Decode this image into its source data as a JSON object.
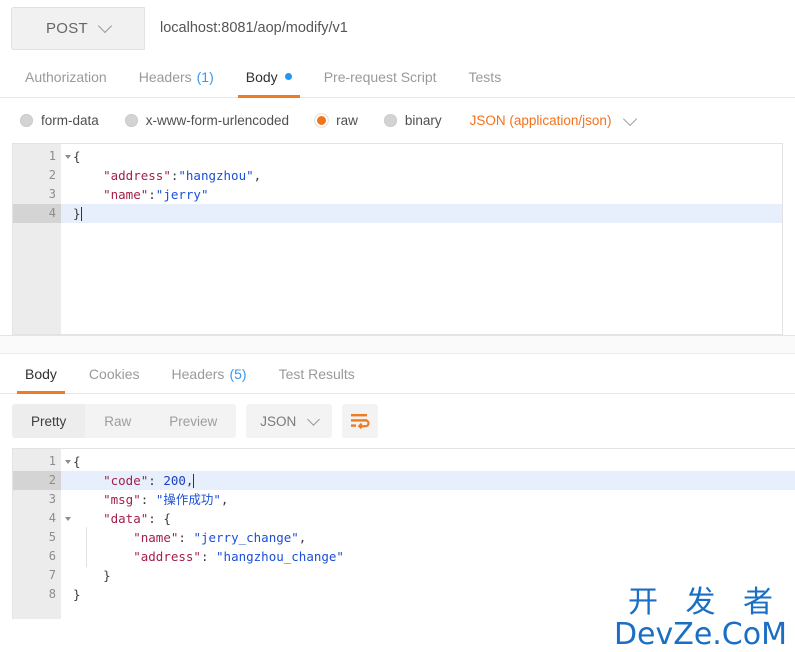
{
  "request": {
    "method": "POST",
    "url": "localhost:8081/aop/modify/v1",
    "tabs": [
      {
        "label": "Authorization",
        "count": "",
        "active": false,
        "dot": false
      },
      {
        "label": "Headers",
        "count": "(1)",
        "active": false,
        "dot": false
      },
      {
        "label": "Body",
        "count": "",
        "active": true,
        "dot": true
      },
      {
        "label": "Pre-request Script",
        "count": "",
        "active": false,
        "dot": false
      },
      {
        "label": "Tests",
        "count": "",
        "active": false,
        "dot": false
      }
    ],
    "body_types": [
      {
        "label": "form-data",
        "selected": false
      },
      {
        "label": "x-www-form-urlencoded",
        "selected": false
      },
      {
        "label": "raw",
        "selected": true
      },
      {
        "label": "binary",
        "selected": false
      }
    ],
    "content_type": "JSON (application/json)",
    "body_lines": [
      {
        "n": "1",
        "fold": true,
        "active": false,
        "tokens": [
          {
            "t": "{",
            "c": "p"
          }
        ]
      },
      {
        "n": "2",
        "fold": false,
        "active": false,
        "tokens": [
          {
            "t": "    ",
            "c": "p"
          },
          {
            "t": "\"address\"",
            "c": "k"
          },
          {
            "t": ":",
            "c": "p"
          },
          {
            "t": "\"hangzhou\"",
            "c": "v"
          },
          {
            "t": ",",
            "c": "p"
          }
        ]
      },
      {
        "n": "3",
        "fold": false,
        "active": false,
        "tokens": [
          {
            "t": "    ",
            "c": "p"
          },
          {
            "t": "\"name\"",
            "c": "k"
          },
          {
            "t": ":",
            "c": "p"
          },
          {
            "t": "\"jerry\"",
            "c": "v"
          }
        ]
      },
      {
        "n": "4",
        "fold": false,
        "active": true,
        "tokens": [
          {
            "t": "}",
            "c": "p"
          }
        ],
        "caret": true
      }
    ]
  },
  "response": {
    "tabs": [
      {
        "label": "Body",
        "count": "",
        "active": true
      },
      {
        "label": "Cookies",
        "count": "",
        "active": false
      },
      {
        "label": "Headers",
        "count": "(5)",
        "active": false
      },
      {
        "label": "Test Results",
        "count": "",
        "active": false
      }
    ],
    "view_modes": [
      {
        "label": "Pretty",
        "active": true
      },
      {
        "label": "Raw",
        "active": false
      },
      {
        "label": "Preview",
        "active": false
      }
    ],
    "format": "JSON",
    "wrap_icon": "word-wrap-icon",
    "body_lines": [
      {
        "n": "1",
        "fold": true,
        "active": false,
        "tokens": [
          {
            "t": "{",
            "c": "p"
          }
        ]
      },
      {
        "n": "2",
        "fold": false,
        "active": true,
        "tokens": [
          {
            "t": "    ",
            "c": "p"
          },
          {
            "t": "\"code\"",
            "c": "k"
          },
          {
            "t": ": ",
            "c": "p"
          },
          {
            "t": "200",
            "c": "num"
          },
          {
            "t": ",",
            "c": "p"
          }
        ],
        "caret": true
      },
      {
        "n": "3",
        "fold": false,
        "active": false,
        "tokens": [
          {
            "t": "    ",
            "c": "p"
          },
          {
            "t": "\"msg\"",
            "c": "k"
          },
          {
            "t": ": ",
            "c": "p"
          },
          {
            "t": "\"操作成功\"",
            "c": "v"
          },
          {
            "t": ",",
            "c": "p"
          }
        ]
      },
      {
        "n": "4",
        "fold": true,
        "active": false,
        "tokens": [
          {
            "t": "    ",
            "c": "p"
          },
          {
            "t": "\"data\"",
            "c": "k"
          },
          {
            "t": ": ",
            "c": "p"
          },
          {
            "t": "{",
            "c": "p"
          }
        ]
      },
      {
        "n": "5",
        "fold": false,
        "active": false,
        "tokens": [
          {
            "t": "        ",
            "c": "p"
          },
          {
            "t": "\"name\"",
            "c": "k"
          },
          {
            "t": ": ",
            "c": "p"
          },
          {
            "t": "\"jerry_change\"",
            "c": "v"
          },
          {
            "t": ",",
            "c": "p"
          }
        ]
      },
      {
        "n": "6",
        "fold": false,
        "active": false,
        "tokens": [
          {
            "t": "        ",
            "c": "p"
          },
          {
            "t": "\"address\"",
            "c": "k"
          },
          {
            "t": ": ",
            "c": "p"
          },
          {
            "t": "\"hangzhou_change\"",
            "c": "v"
          }
        ]
      },
      {
        "n": "7",
        "fold": false,
        "active": false,
        "tokens": [
          {
            "t": "    ",
            "c": "p"
          },
          {
            "t": "}",
            "c": "p"
          }
        ]
      },
      {
        "n": "8",
        "fold": false,
        "active": false,
        "tokens": [
          {
            "t": "}",
            "c": "p"
          }
        ]
      }
    ]
  },
  "watermark": {
    "line1": "开 发 者",
    "line2": "DevZe.CoM",
    "color": "#1a6fc4"
  },
  "colors": {
    "accent": "#ef7b22",
    "link": "#3898ec",
    "json_key": "#a3204a",
    "json_value": "#1c4fd8"
  }
}
